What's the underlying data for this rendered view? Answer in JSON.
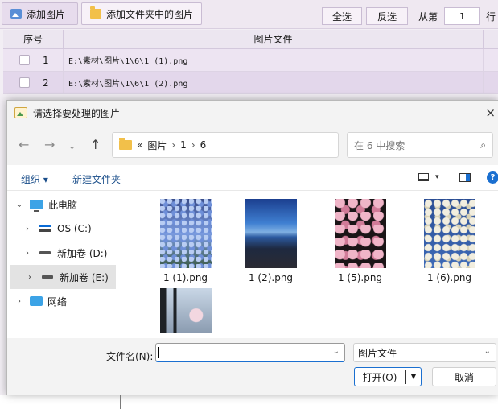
{
  "app": {
    "toolbar": {
      "add_image_label": "添加图片",
      "add_folder_label": "添加文件夹中的图片",
      "select_all_label": "全选",
      "invert_label": "反选",
      "from_label": "从第",
      "from_value": "1",
      "row_label": "行"
    },
    "table": {
      "col_index": "序号",
      "col_file": "图片文件",
      "rows": [
        {
          "index": "1",
          "path": "E:\\素材\\图片\\1\\6\\1  (1).png"
        },
        {
          "index": "2",
          "path": "E:\\素材\\图片\\1\\6\\1  (2).png"
        }
      ]
    }
  },
  "dialog": {
    "title": "请选择要处理的图片",
    "close_glyph": "×",
    "nav": {
      "back": "←",
      "forward": "→",
      "recent": "⌄",
      "up": "↑",
      "dropdown": "⌄",
      "refresh": "↻"
    },
    "address": {
      "overflow": "«",
      "crumbs": [
        "图片",
        "1",
        "6"
      ],
      "separator": "›"
    },
    "search_placeholder": "在 6 中搜索",
    "search_glyph": "⌕",
    "commands": {
      "organize": "组织 ▾",
      "new_folder": "新建文件夹",
      "view_dropdown": "▾",
      "help": "?"
    },
    "tree": [
      {
        "label": "此电脑",
        "chevron": "⌄"
      },
      {
        "label": "OS (C:)",
        "chevron": "›"
      },
      {
        "label": "新加卷 (D:)",
        "chevron": "›"
      },
      {
        "label": "新加卷 (E:)",
        "chevron": "›"
      },
      {
        "label": "网络",
        "chevron": "›"
      }
    ],
    "files": [
      {
        "name": "1 (1).png"
      },
      {
        "name": "1 (2).png"
      },
      {
        "name": "1 (5).png"
      },
      {
        "name": "1 (6).png"
      },
      {
        "name": ""
      }
    ],
    "footer": {
      "filename_label": "文件名(N):",
      "filename_value": "",
      "filetype_value": "图片文件",
      "dropdown": "⌄",
      "open_label": "打开(O)",
      "open_arrow": "▼",
      "cancel_label": "取消"
    }
  }
}
